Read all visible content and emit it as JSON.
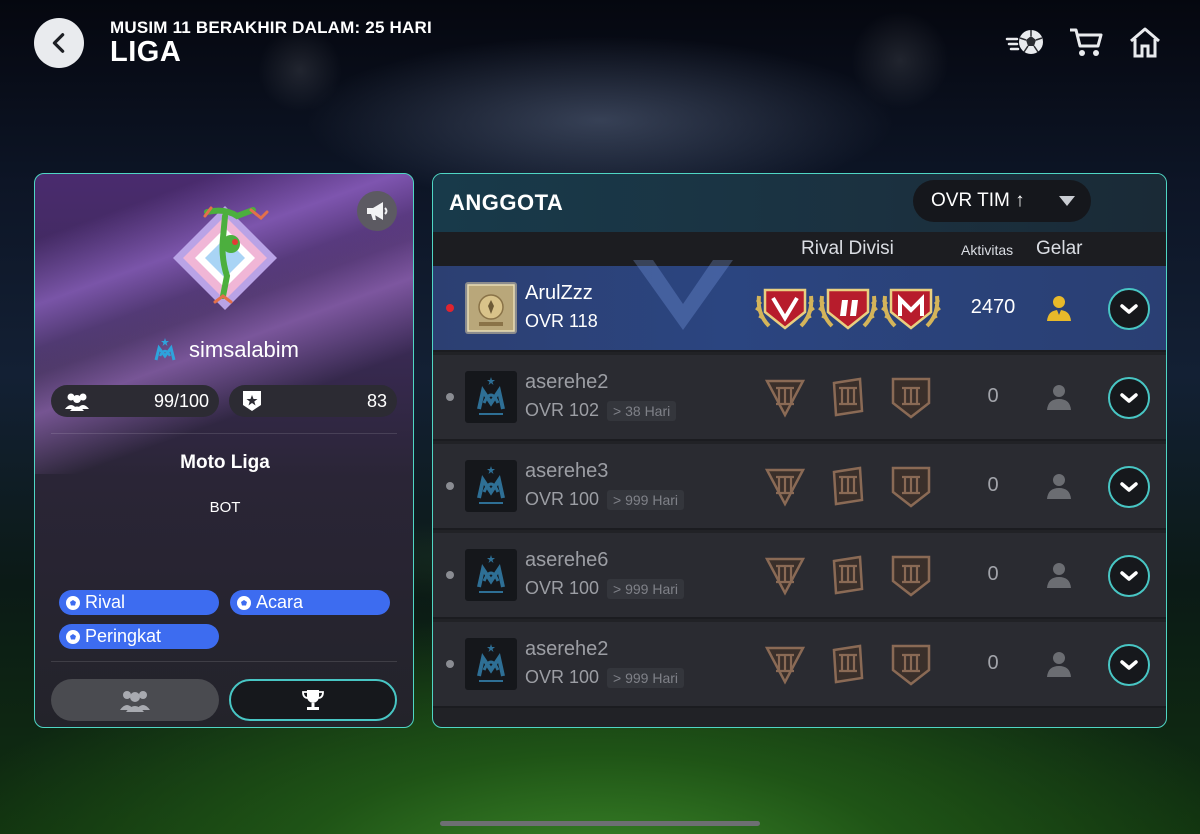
{
  "header": {
    "season_text": "MUSIM 11 BERAKHIR DALAM: 25 HARI",
    "title": "LIGA",
    "icons": [
      "back-arrow-icon",
      "football-icon",
      "shopping-cart-icon",
      "home-icon"
    ]
  },
  "club": {
    "name": "simsalabim",
    "members": "99/100",
    "rating": "83",
    "league_name": "Moto Liga",
    "league_type": "BOT",
    "tags": [
      "Rival",
      "Acara",
      "Peringkat"
    ]
  },
  "members_panel": {
    "title": "ANGGOTA",
    "sort_label": "OVR TIM ↑",
    "col_rival": "Rival Divisi",
    "col_activity": "Aktivitas",
    "col_title": "Gelar",
    "members": [
      {
        "name": "ArulZzz",
        "ovr": "OVR 118",
        "last_seen": "",
        "activity": "2470",
        "online": true
      },
      {
        "name": "aserehe2",
        "ovr": "OVR 102",
        "last_seen": "> 38 Hari",
        "activity": "0",
        "online": false
      },
      {
        "name": "aserehe3",
        "ovr": "OVR 100",
        "last_seen": "> 999 Hari",
        "activity": "0",
        "online": false
      },
      {
        "name": "aserehe6",
        "ovr": "OVR 100",
        "last_seen": "> 999 Hari",
        "activity": "0",
        "online": false
      },
      {
        "name": "aserehe2",
        "ovr": "OVR 100",
        "last_seen": "> 999 Hari",
        "activity": "0",
        "online": false
      }
    ]
  },
  "colors": {
    "accent": "#4fd6c4",
    "tag_blue": "#3d6cf0",
    "active_row": "#2b4580",
    "gold": "#d4b45a",
    "online_dot": "#e0242f"
  }
}
